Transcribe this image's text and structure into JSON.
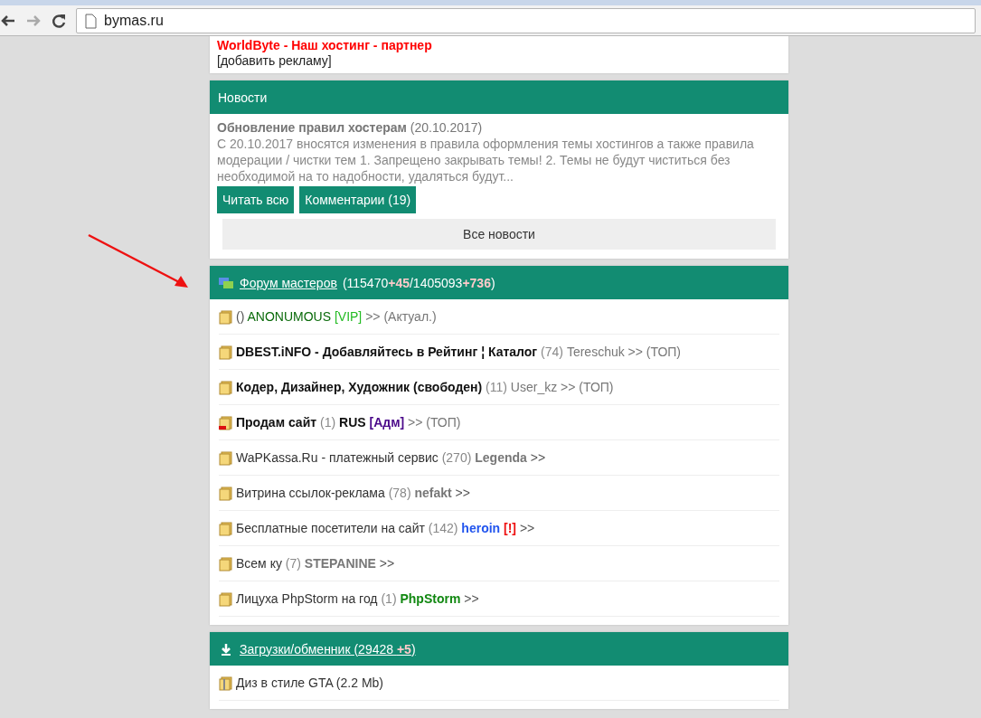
{
  "browser": {
    "url": "bymas.ru"
  },
  "ads": {
    "partner": "WorldByte - Наш хостинг - партнер",
    "add_link": "[добавить рекламу]"
  },
  "news": {
    "title": "Новости",
    "item_title": "Обновление правил хостерам",
    "item_date": "(20.10.2017)",
    "item_text": "С 20.10.2017 вносятся изменения в правила оформления темы хостингов а также правила модерации / чистки тем 1. Запрещено закрывать темы! 2. Темы не будут чиститься без необходимой на то надобности, удаляться будут...",
    "buttons": [
      "Читать всю",
      "Комментарии (19)"
    ],
    "all_link": "Все новости"
  },
  "forum": {
    "title": "Форум мастеров",
    "stats": [
      {
        "text": "(115470",
        "new": false
      },
      {
        "text": "+45",
        "new": true
      },
      {
        "text": "/1405093",
        "new": false
      },
      {
        "text": "+736",
        "new": true
      },
      {
        "text": ")",
        "new": false
      }
    ],
    "topics": [
      {
        "kind": "open",
        "parts": [
          {
            "text": "()",
            "color": "#555555",
            "bold": false
          },
          {
            "text": "ANONUMOUS",
            "color": "#0a6a0a",
            "bold": false
          },
          {
            "text": "[VIP]",
            "color": "#22bb22",
            "bold": false
          },
          {
            "text": ">> (Актуал.)",
            "color": "#777777",
            "bold": false
          }
        ]
      },
      {
        "kind": "open",
        "parts": [
          {
            "text": "DBEST.iNFO - Добавляйтесь в Рейтинг ¦ Каталог",
            "color": "#111111",
            "bold": true
          },
          {
            "text": "(74)",
            "color": "#888888",
            "bold": false
          },
          {
            "text": "Tereschuk",
            "color": "#777777",
            "bold": false
          },
          {
            "text": ">> (ТОП)",
            "color": "#777777",
            "bold": false
          }
        ]
      },
      {
        "kind": "open",
        "parts": [
          {
            "text": "Кодер, Дизайнер, Художник (свободен)",
            "color": "#111111",
            "bold": true
          },
          {
            "text": "(11)",
            "color": "#888888",
            "bold": false
          },
          {
            "text": "User_kz",
            "color": "#777777",
            "bold": false
          },
          {
            "text": ">> (ТОП)",
            "color": "#777777",
            "bold": false
          }
        ]
      },
      {
        "kind": "closed",
        "parts": [
          {
            "text": "Продам сайт",
            "color": "#111111",
            "bold": true
          },
          {
            "text": "(1)",
            "color": "#888888",
            "bold": false
          },
          {
            "text": "RUS",
            "color": "#111111",
            "bold": true
          },
          {
            "text": "[Адм]",
            "color": "#4b0a8a",
            "bold": true
          },
          {
            "text": ">> (ТОП)",
            "color": "#777777",
            "bold": false
          }
        ]
      },
      {
        "kind": "open",
        "parts": [
          {
            "text": "WaPKassa.Ru - платежный сервис",
            "color": "#333333",
            "bold": false
          },
          {
            "text": "(270)",
            "color": "#888888",
            "bold": false
          },
          {
            "text": "Legenda",
            "color": "#777777",
            "bold": true
          },
          {
            "text": ">>",
            "color": "#555555",
            "bold": false
          }
        ]
      },
      {
        "kind": "open",
        "parts": [
          {
            "text": "Витрина ссылок-реклама",
            "color": "#333333",
            "bold": false
          },
          {
            "text": "(78)",
            "color": "#888888",
            "bold": false
          },
          {
            "text": "nefakt",
            "color": "#777777",
            "bold": true
          },
          {
            "text": ">>",
            "color": "#555555",
            "bold": false
          }
        ]
      },
      {
        "kind": "open",
        "parts": [
          {
            "text": "Бесплатные посетители на сайт",
            "color": "#333333",
            "bold": false
          },
          {
            "text": "(142)",
            "color": "#888888",
            "bold": false
          },
          {
            "text": "heroin",
            "color": "#2255ee",
            "bold": true
          },
          {
            "text": "[!]",
            "color": "#ee1111",
            "bold": true
          },
          {
            "text": ">>",
            "color": "#555555",
            "bold": false
          }
        ]
      },
      {
        "kind": "open",
        "parts": [
          {
            "text": "Всем ку",
            "color": "#333333",
            "bold": false
          },
          {
            "text": "(7)",
            "color": "#888888",
            "bold": false
          },
          {
            "text": "STEPANINE",
            "color": "#777777",
            "bold": true
          },
          {
            "text": ">>",
            "color": "#555555",
            "bold": false
          }
        ]
      },
      {
        "kind": "open",
        "parts": [
          {
            "text": "Лицуха PhpStorm на год",
            "color": "#333333",
            "bold": false
          },
          {
            "text": "(1)",
            "color": "#888888",
            "bold": false
          },
          {
            "text": "PhpStorm",
            "color": "#118811",
            "bold": true
          },
          {
            "text": ">>",
            "color": "#555555",
            "bold": false
          }
        ]
      }
    ]
  },
  "downloads": {
    "title": "Загрузки/обменник (29428",
    "added": "+5",
    "close": ")",
    "files": [
      {
        "name": "Диз в стиле GTA (2.2 Mb)"
      }
    ]
  }
}
